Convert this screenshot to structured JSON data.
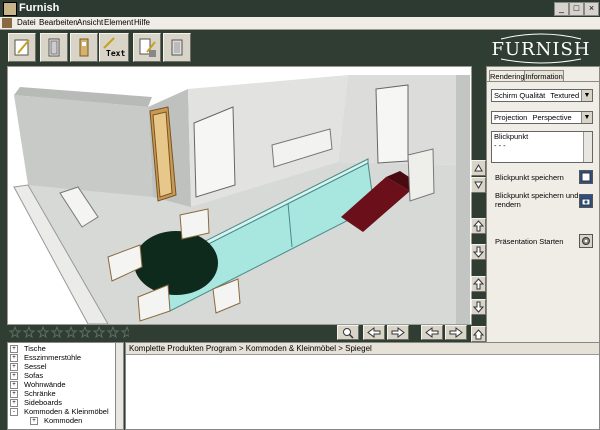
{
  "window": {
    "title": "Furnish",
    "minimize": "_",
    "maximize": "□",
    "close": "×"
  },
  "menu": [
    "Datei",
    "Bearbeiten",
    "Ansicht",
    "Element",
    "Hilfe"
  ],
  "toolbar": {
    "text_tool_label": "Text"
  },
  "logo": {
    "text": "FURNISH"
  },
  "panel": {
    "tabs": [
      "Rendering",
      "Information"
    ],
    "quality_label": "Schirm Qualität",
    "quality_value": "Textured",
    "projection_label": "Projection",
    "projection_value": "Perspective",
    "viewpoint_title": "Blickpunkt",
    "viewpoint_list": "- - -",
    "save_viewpoint": "Blickpunkt speichern",
    "save_render_line1": "Blickpunkt speichern und",
    "save_render_line2": "rendern",
    "presentation": "Präsentation Starten"
  },
  "tree": {
    "items": [
      {
        "label": "Tische",
        "toggle": "+",
        "level": 0
      },
      {
        "label": "Esszimmerstühle",
        "toggle": "+",
        "level": 0
      },
      {
        "label": "Sessel",
        "toggle": "+",
        "level": 0
      },
      {
        "label": "Sofas",
        "toggle": "+",
        "level": 0
      },
      {
        "label": "Wohnwände",
        "toggle": "+",
        "level": 0
      },
      {
        "label": "Schränke",
        "toggle": "+",
        "level": 0
      },
      {
        "label": "Sideboards",
        "toggle": "+",
        "level": 0
      },
      {
        "label": "Kommoden & Kleinmöbel",
        "toggle": "-",
        "level": 0
      },
      {
        "label": "Kommoden",
        "toggle": "+",
        "level": 1
      }
    ]
  },
  "breadcrumb": {
    "text": "Komplette Produkten Program > Kommoden & Kleinmöbel > Spiegel"
  },
  "colors": {
    "frame": "#2f3d33",
    "panel": "#f0ede6",
    "rug": "#6b0f1a",
    "table": "#0e2a1c",
    "glass": "#a8e6e0"
  }
}
